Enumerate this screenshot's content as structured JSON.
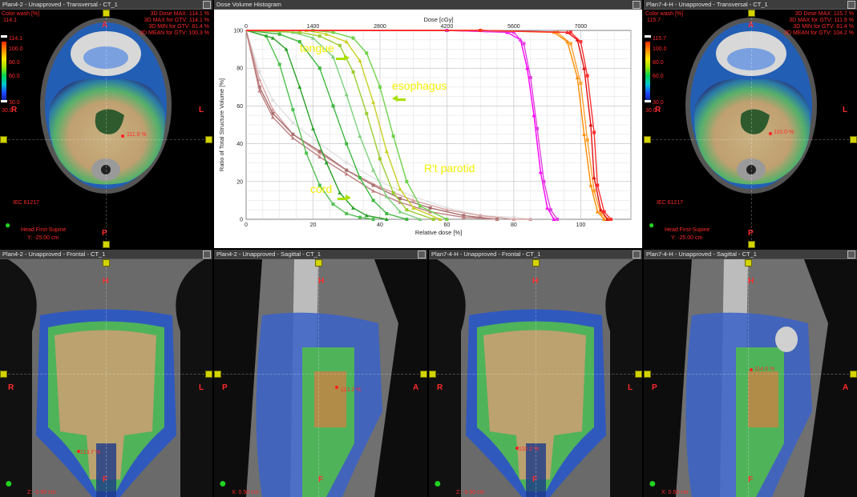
{
  "panels": {
    "tl": {
      "title": "Plan4-2  -  Unapproved - Transversal - CT_1",
      "colorwash_label": "Color wash [%]",
      "colorwash_value": "114.1",
      "cb_top": "114.1",
      "cb_mid1": "100.0",
      "cb_mid2": "80.0",
      "cb_mid3": "60.0",
      "cb_low": "30.0",
      "cb_bottom": "30.0",
      "stats": [
        "3D Dose MAX: 114.1 %",
        "3D MAX for GTV: 114.1 %",
        "3D MIN for GTV: 81.4 %",
        "3D MEAN for GTV: 100.3 %"
      ],
      "hotspot": "111.0 %",
      "iec": "IEC 61217",
      "orientation": "Head First-Supine",
      "slice": "Y: -25.00 cm",
      "A": "A",
      "P": "P",
      "R": "R",
      "L": "L"
    },
    "dvh": {
      "title": "Dose Volume Histogram"
    },
    "tr": {
      "title": "Plan7-4-H  -  Unapproved - Transversal - CT_1",
      "colorwash_label": "Color wash [%]",
      "colorwash_value": "115.7",
      "cb_top": "115.7",
      "cb_mid1": "100.0",
      "cb_mid2": "80.0",
      "cb_mid3": "60.0",
      "cb_low": "30.0",
      "cb_bottom": "30.0",
      "stats": [
        "3D Dose MAX: 115.7 %",
        "3D MAX for GTV: 111.9 %",
        "3D MIN for GTV: 81.4 %",
        "3D MEAN for GTV: 104.2 %"
      ],
      "hotspot": "110.0 %",
      "iec": "IEC 61217",
      "orientation": "Head First-Supine",
      "slice": "Y: -25.00 cm",
      "A": "A",
      "P": "P",
      "R": "R",
      "L": "L"
    },
    "bl1": {
      "title": "Plan4-2  -  Unapproved - Frontal - CT_1",
      "hotspot": "113.7 %",
      "H": "H",
      "F": "F",
      "R": "R",
      "L": "L",
      "z": "Z: -0.90 cm"
    },
    "bl2": {
      "title": "Plan4-2  -  Unapproved - Sagittal - CT_1",
      "hotspot": "113.2 %",
      "H": "H",
      "F": "F",
      "P": "P",
      "A": "A",
      "x": "X: 0.50 cm"
    },
    "bl3": {
      "title": "Plan7-4-H  -  Unapproved - Frontal - CT_1",
      "hotspot": "110.2 %",
      "H": "H",
      "F": "F",
      "R": "R",
      "L": "L",
      "z": "Z: -0.90 cm"
    },
    "bl4": {
      "title": "Plan7-4-H  -  Unapproved - Sagittal - CT_1",
      "hotspot": "114.0 %",
      "H": "H",
      "F": "F",
      "P": "P",
      "A": "A",
      "x": "X: 0.50 cm"
    }
  },
  "chart_data": {
    "type": "line",
    "title": "",
    "xlabel": "Relative dose [%]",
    "x2label": "Dose [cGy]",
    "ylabel": "Ratio of Total Structure Volume [%]",
    "xlim": [
      0,
      115
    ],
    "ylim": [
      0,
      100
    ],
    "xticks": [
      0,
      20,
      40,
      60,
      80,
      100
    ],
    "x2ticks": [
      "0",
      "1400",
      "2800",
      "4200",
      "5600",
      "7000"
    ],
    "yticks": [
      0,
      20,
      40,
      60,
      80,
      100
    ],
    "grid": true,
    "annotations": [
      "tongue",
      "esophagus",
      "R't parotid",
      "cord"
    ],
    "series": [
      {
        "color": "#e0e0e0",
        "x": [
          0,
          4,
          8,
          14,
          22,
          30,
          40,
          50,
          60,
          70,
          80,
          85
        ],
        "y": [
          100,
          78,
          63,
          51,
          40,
          30,
          20,
          12,
          6,
          2,
          1,
          0
        ]
      },
      {
        "color": "#d8a0a0",
        "x": [
          0,
          4,
          8,
          14,
          22,
          30,
          40,
          50,
          60,
          70,
          80,
          85
        ],
        "y": [
          100,
          74,
          58,
          45,
          35,
          26,
          17,
          10,
          5,
          2,
          0,
          0
        ]
      },
      {
        "color": "#a87070",
        "x": [
          0,
          4,
          8,
          14,
          22,
          30,
          38,
          46,
          55,
          65,
          75
        ],
        "y": [
          100,
          70,
          56,
          45,
          36,
          26,
          18,
          11,
          6,
          2,
          0
        ]
      },
      {
        "color": "#c08080",
        "x": [
          0,
          4,
          8,
          14,
          22,
          30,
          38,
          46,
          55,
          65,
          75
        ],
        "y": [
          100,
          68,
          54,
          43,
          33,
          24,
          15,
          9,
          4,
          1,
          0
        ]
      },
      {
        "color": "#50c050",
        "x": [
          0,
          6,
          10,
          14,
          18,
          22,
          26,
          30,
          34,
          38
        ],
        "y": [
          100,
          97,
          82,
          58,
          35,
          18,
          8,
          3,
          1,
          0
        ]
      },
      {
        "color": "#28a028",
        "x": [
          0,
          8,
          12,
          16,
          20,
          24,
          28,
          32,
          36,
          42
        ],
        "y": [
          100,
          96,
          90,
          70,
          48,
          30,
          14,
          6,
          2,
          0
        ]
      },
      {
        "color": "#40b840",
        "x": [
          0,
          10,
          16,
          22,
          26,
          30,
          34,
          38,
          42,
          48
        ],
        "y": [
          100,
          98,
          94,
          80,
          60,
          40,
          22,
          10,
          3,
          0
        ]
      },
      {
        "color": "#7ad07a",
        "x": [
          0,
          14,
          20,
          26,
          30,
          34,
          38,
          42,
          46,
          52
        ],
        "y": [
          100,
          99,
          96,
          86,
          66,
          44,
          26,
          12,
          4,
          0
        ]
      },
      {
        "color": "#9acd32",
        "x": [
          0,
          16,
          22,
          28,
          32,
          36,
          40,
          44,
          48,
          56
        ],
        "y": [
          100,
          99,
          97,
          92,
          78,
          56,
          32,
          14,
          5,
          0
        ]
      },
      {
        "color": "#c8d020",
        "x": [
          0,
          18,
          24,
          30,
          34,
          38,
          42,
          46,
          50,
          58
        ],
        "y": [
          100,
          100,
          98,
          94,
          84,
          62,
          36,
          16,
          6,
          0
        ]
      },
      {
        "color": "#6fd24a",
        "x": [
          0,
          20,
          26,
          32,
          36,
          40,
          44,
          48,
          52,
          60
        ],
        "y": [
          100,
          100,
          99,
          96,
          88,
          70,
          44,
          20,
          7,
          0
        ]
      },
      {
        "color": "#ff00ff",
        "x": [
          0,
          60,
          78,
          82,
          84,
          86,
          88,
          90,
          92
        ],
        "y": [
          100,
          100,
          99,
          95,
          80,
          55,
          25,
          6,
          0
        ]
      },
      {
        "color": "#e040e0",
        "x": [
          0,
          60,
          80,
          83,
          85,
          87,
          89,
          91,
          93
        ],
        "y": [
          100,
          100,
          99,
          93,
          75,
          48,
          20,
          5,
          0
        ]
      },
      {
        "color": "#ff8c00",
        "x": [
          0,
          70,
          92,
          96,
          99,
          101,
          103,
          105,
          107
        ],
        "y": [
          100,
          100,
          99,
          94,
          75,
          45,
          18,
          4,
          0
        ]
      },
      {
        "color": "#ffa030",
        "x": [
          0,
          70,
          93,
          97,
          100,
          102,
          104,
          106,
          108
        ],
        "y": [
          100,
          100,
          99,
          93,
          72,
          42,
          15,
          3,
          0
        ]
      },
      {
        "color": "#e01010",
        "x": [
          0,
          70,
          96,
          99,
          101,
          103,
          104,
          106,
          108
        ],
        "y": [
          100,
          100,
          99,
          95,
          80,
          50,
          22,
          5,
          0
        ]
      },
      {
        "color": "#ff3030",
        "x": [
          0,
          70,
          97,
          100,
          102,
          104,
          105,
          107,
          109
        ],
        "y": [
          100,
          100,
          99,
          94,
          76,
          46,
          18,
          4,
          0
        ]
      }
    ]
  }
}
